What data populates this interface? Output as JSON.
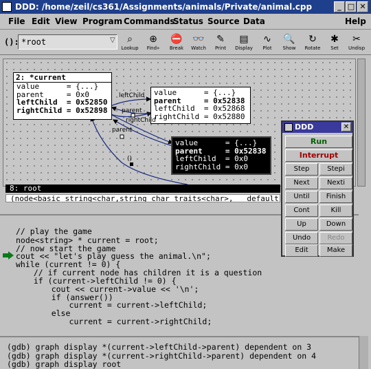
{
  "window": {
    "title": "DDD: /home/zeil/cs361/Assignments/animals/Private/animal.cpp"
  },
  "menubar": {
    "items": [
      "File",
      "Edit",
      "View",
      "Program",
      "Commands",
      "Status",
      "Source",
      "Data"
    ],
    "help": "Help"
  },
  "toolbar": {
    "arg_label": "():",
    "arg_value": "*root",
    "tools": [
      {
        "name": "lookup",
        "label": "Lookup",
        "icon": "lookup-icon"
      },
      {
        "name": "find",
        "label": "Find»",
        "icon": "find-icon"
      },
      {
        "name": "break",
        "label": "Break",
        "icon": "break-icon"
      },
      {
        "name": "watch",
        "label": "Watch",
        "icon": "watch-icon"
      },
      {
        "name": "print",
        "label": "Print",
        "icon": "print-icon"
      },
      {
        "name": "display",
        "label": "Display",
        "icon": "display-icon"
      },
      {
        "name": "plot",
        "label": "Plot",
        "icon": "plot-icon"
      },
      {
        "name": "show",
        "label": "Show",
        "icon": "show-icon"
      },
      {
        "name": "rotate",
        "label": "Rotate",
        "icon": "rotate-icon"
      },
      {
        "name": "set",
        "label": "Set",
        "icon": "set-icon"
      },
      {
        "name": "undisp",
        "label": "Undisp",
        "icon": "undisp-icon"
      }
    ]
  },
  "data_display": {
    "node_current": {
      "header": "2: *current",
      "rows": [
        "value      = {...}",
        "parent     = 0x0",
        "leftChild  = 0x52850",
        "rightChild = 0x52898"
      ]
    },
    "node_left": {
      "rows": [
        "value      = {...}",
        "parent     = 0x52838",
        "leftChild  = 0x52868",
        "rightChild = 0x52880"
      ]
    },
    "node_right": {
      "rows": [
        "value      = {...}",
        "parent     = 0x52838",
        "leftChild  = 0x0",
        "rightChild = 0x0"
      ]
    },
    "edge_labels": [
      "leftChild",
      "parent",
      "rightChild",
      "parent",
      "()"
    ]
  },
  "status": {
    "line1": "8: root",
    "line2": "(node<basic_string<char,string_char_traits<char>, __default_all"
  },
  "source": {
    "lines": [
      "// play the game",
      "node<string> * current = root;",
      "// now start the game",
      "cout << \"let's play guess the animal.\\n\";",
      "while (current != 0) {",
      "  // if current node has children it is a question",
      "  if (current->leftChild != 0) {",
      "    cout << current->value << '\\n';",
      "    if (answer())",
      "      current = current->leftChild;",
      "    else",
      "      current = current->rightChild;"
    ]
  },
  "console": {
    "lines": [
      "(gdb) graph display *(current->leftChild->parent) dependent on 3",
      "(gdb) graph display *(current->rightChild->parent) dependent on 4",
      "(gdb) graph display root"
    ]
  },
  "command_tool": {
    "title": "DDD",
    "run": "Run",
    "interrupt": "Interrupt",
    "run_color": "#006000",
    "interrupt_color": "#a00000",
    "buttons": [
      "Step",
      "Stepi",
      "Next",
      "Nexti",
      "Until",
      "Finish",
      "Cont",
      "Kill",
      "Up",
      "Down",
      "Undo",
      "Redo",
      "Edit",
      "Make"
    ]
  }
}
